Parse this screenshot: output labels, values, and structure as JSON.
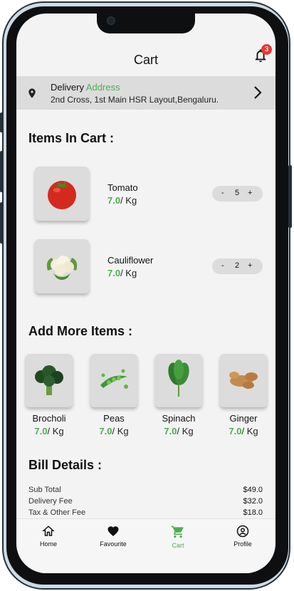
{
  "header": {
    "title": "Cart",
    "notification_count": "3"
  },
  "delivery": {
    "label_prefix": "Delivery",
    "label_accent": "Address",
    "address": "2nd Cross, 1st Main HSR Layout,Bengaluru."
  },
  "cart": {
    "title": "Items In Cart :",
    "items": [
      {
        "name": "Tomato",
        "price": "7.0",
        "unit": "/ Kg",
        "quantity": "5",
        "icon": "tomato"
      },
      {
        "name": "Cauliflower",
        "price": "7.0",
        "unit": "/ Kg",
        "quantity": "2",
        "icon": "cauliflower"
      }
    ],
    "minus": "-",
    "plus": "+"
  },
  "more": {
    "title": "Add More Items :",
    "items": [
      {
        "name": "Brocholi",
        "price": "7.0",
        "unit": "/ Kg",
        "icon": "broccoli"
      },
      {
        "name": "Peas",
        "price": "7.0",
        "unit": "/ Kg",
        "icon": "peas"
      },
      {
        "name": "Spinach",
        "price": "7.0",
        "unit": "/ Kg",
        "icon": "spinach"
      },
      {
        "name": "Ginger",
        "price": "7.0",
        "unit": "/ Kg",
        "icon": "ginger"
      }
    ]
  },
  "bill": {
    "title": "Bill Details :",
    "rows": [
      {
        "label": "Sub Total",
        "amount": "$49.0"
      },
      {
        "label": "Delivery Fee",
        "amount": "$32.0"
      },
      {
        "label": "Tax & Other Fee",
        "amount": "$18.0"
      }
    ]
  },
  "nav": {
    "items": [
      {
        "label": "Home",
        "icon": "home-icon"
      },
      {
        "label": "Favourite",
        "icon": "heart-icon"
      },
      {
        "label": "Cart",
        "icon": "cart-icon",
        "active": true
      },
      {
        "label": "Profile",
        "icon": "profile-icon"
      }
    ]
  },
  "colors": {
    "accent": "#4caf50",
    "badge": "#e53935",
    "surface": "#f3f3f3",
    "card": "#dcdcdc"
  }
}
